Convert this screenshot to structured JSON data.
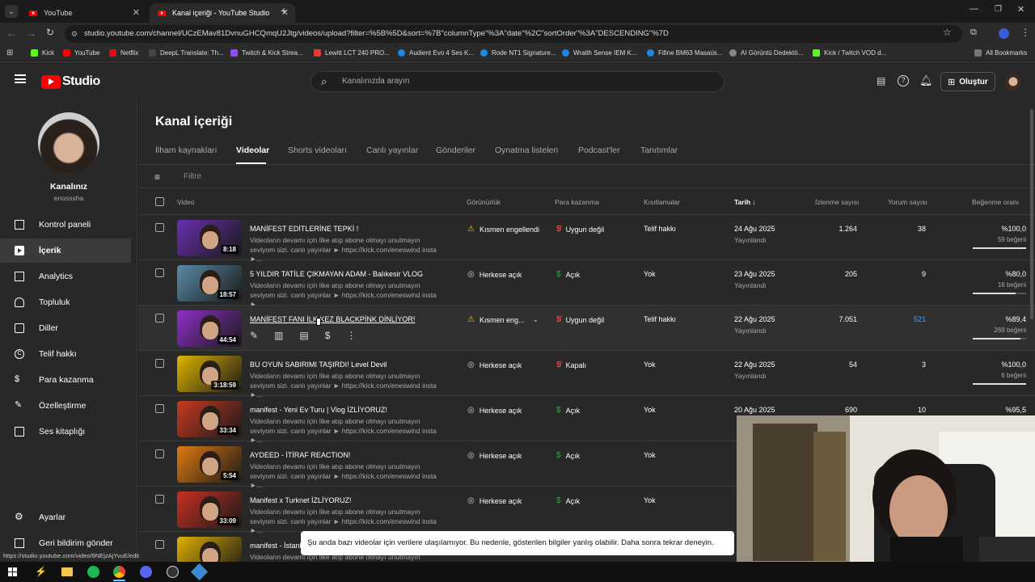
{
  "browser": {
    "tabs": [
      {
        "label": "YouTube"
      },
      {
        "label": "Kanal içeriği - YouTube Studio"
      }
    ],
    "url": "studio.youtube.com/channel/UCzEMav81DvnuGHCQmqU2Jtg/videos/upload?filter=%5B%5D&sort=%7B\"columnType\"%3A\"date\"%2C\"sortOrder\"%3A\"DESCENDING\"%7D",
    "bookmarks": [
      "Kick",
      "YouTube",
      "Netflix",
      "DeepL Translate: Th...",
      "Twitch & Kick Strea...",
      "Lewitt LCT 240 PRO...",
      "Audient Evo 4 Ses K...",
      "Rode NT1 Signature...",
      "Wraith Sense IEM K...",
      "Fifine BM63 Masaüs...",
      "AI Görüntü Dedektö...",
      "Kick / Twitch VOD d...",
      "All Bookmarks"
    ],
    "status_url": "https://studio.youtube.com/video/9NEjzAjYvuE/edit"
  },
  "header": {
    "logo_text": "Studio",
    "search_placeholder": "Kanalınızda arayın",
    "create_label": "Oluştur"
  },
  "sidebar": {
    "channel_title": "Kanalınız",
    "channel_handle": "enosssha",
    "items": [
      {
        "label": "Kontrol paneli",
        "icon": "dashboard-icon"
      },
      {
        "label": "İçerik",
        "icon": "content-icon"
      },
      {
        "label": "Analytics",
        "icon": "analytics-icon"
      },
      {
        "label": "Topluluk",
        "icon": "community-icon"
      },
      {
        "label": "Diller",
        "icon": "subtitles-icon"
      },
      {
        "label": "Telif hakkı",
        "icon": "copyright-icon"
      },
      {
        "label": "Para kazanma",
        "icon": "monetization-icon"
      },
      {
        "label": "Özelleştirme",
        "icon": "customization-icon"
      },
      {
        "label": "Ses kitaplığı",
        "icon": "audio-library-icon"
      }
    ],
    "bottom": [
      {
        "label": "Ayarlar",
        "icon": "settings-icon"
      },
      {
        "label": "Geri bildirim gönder",
        "icon": "feedback-icon"
      }
    ]
  },
  "main": {
    "page_title": "Kanal içeriği",
    "tabs": [
      "İlham kaynakları",
      "Videolar",
      "Shorts videoları",
      "Canlı yayınlar",
      "Gönderiler",
      "Oynatma listeleri",
      "Podcast'ler",
      "Tanıtımlar"
    ],
    "filter_placeholder": "Filtre",
    "columns": {
      "video": "Video",
      "visibility": "Görünürlük",
      "monetization": "Para kazanma",
      "restrictions": "Kısıtlamalar",
      "date": "Tarih",
      "views": "İzlenme sayısı",
      "comments": "Yorum sayısı",
      "likes": "Beğenme oranı"
    },
    "rows": [
      {
        "title": "MANİFEST EDİTLERİNE TEPKİ !",
        "desc": "Videoların devamı için like atıp abone olmayı unutmayın seviyom sizi. canlı yayınlar ► https://kick.com/eneswind insta ►...",
        "duration": "8:18",
        "visibility": "Kısmen engellendi",
        "vis_icon": "warning-icon",
        "monetization": "Uygun değil",
        "mon_icon": "monetization-off-icon",
        "restrictions": "Telif hakkı",
        "date": "24 Ağu 2025",
        "status": "Yayınlandı",
        "views": "1.264",
        "comments": "38",
        "likes": "%100,0",
        "likes_count": "59 beğeni",
        "like_fraction": 1.0,
        "thumb_color": "#6a2fb0"
      },
      {
        "title": "5 YILDIR TATİLE ÇIKMAYAN ADAM - Balıkesir VLOG",
        "desc": "Videoların devamı için like atıp abone olmayı unutmayın seviyom sizi. canlı yayınlar ► https://kick.com/eneswind insta ►...",
        "duration": "18:57",
        "visibility": "Herkese açık",
        "vis_icon": "public-icon",
        "monetization": "Açık",
        "mon_icon": "monetization-on-icon",
        "restrictions": "Yok",
        "date": "23 Ağu 2025",
        "status": "Yayınlandı",
        "views": "205",
        "comments": "9",
        "likes": "%80,0",
        "likes_count": "16 beğeni",
        "like_fraction": 0.8,
        "thumb_color": "#5a8aa8"
      },
      {
        "title": "MANİFEST FANI İLK KEZ BLACKPİNK DİNLİYOR!",
        "desc": "",
        "duration": "44:54",
        "visibility": "Kısmen eng...",
        "vis_icon": "warning-icon",
        "monetization": "Uygun değil",
        "mon_icon": "monetization-off-icon",
        "restrictions": "Telif hakkı",
        "date": "22 Ağu 2025",
        "status": "Yayınlandı",
        "views": "7.051",
        "comments": "521",
        "likes": "%89,4",
        "likes_count": "269 beğeni",
        "like_fraction": 0.894,
        "thumb_color": "#8e2fc8"
      },
      {
        "title": "BU OYUN SABIRIMI TAŞIRDI! Level Devil",
        "desc": "Videoların devamı için like atıp abone olmayı unutmayın seviyom sizi. canlı yayınlar ► https://kick.com/eneswind insta ►...",
        "duration": "3:18:59",
        "visibility": "Herkese açık",
        "vis_icon": "public-icon",
        "monetization": "Kapalı",
        "mon_icon": "monetization-off-icon",
        "restrictions": "Yok",
        "date": "22 Ağu 2025",
        "status": "Yayınlandı",
        "views": "54",
        "comments": "3",
        "likes": "%100,0",
        "likes_count": "6 beğeni",
        "like_fraction": 1.0,
        "thumb_color": "#e0b400"
      },
      {
        "title": "manifest - Yeni Ev Turu | Vlog İZLİYORUZ!",
        "desc": "Videoların devamı için like atıp abone olmayı unutmayın seviyom sizi. canlı yayınlar ► https://kick.com/eneswind insta ►...",
        "duration": "33:34",
        "visibility": "Herkese açık",
        "vis_icon": "public-icon",
        "monetization": "Açık",
        "mon_icon": "monetization-on-icon",
        "restrictions": "Yok",
        "date": "20 Ağu 2025",
        "status": "",
        "views": "690",
        "comments": "10",
        "likes": "%95,5",
        "likes_count": "",
        "like_fraction": 0.955,
        "thumb_color": "#c83a20"
      },
      {
        "title": "AYDEED - İTİRAF REACTION!",
        "desc": "Videoların devamı için like atıp abone olmayı unutmayın seviyom sizi. canlı yayınlar ► https://kick.com/eneswind insta ►...",
        "duration": "5:54",
        "visibility": "Herkese açık",
        "vis_icon": "public-icon",
        "monetization": "Açık",
        "mon_icon": "monetization-on-icon",
        "restrictions": "Yok",
        "date": "",
        "status": "",
        "views": "",
        "comments": "",
        "likes": "",
        "likes_count": "",
        "like_fraction": 0,
        "thumb_color": "#e07a10"
      },
      {
        "title": "Manifest x Turknet İZLİYORUZ!",
        "desc": "Videoların devamı için like atıp abone olmayı unutmayın seviyom sizi. canlı yayınlar ► https://kick.com/eneswind insta ►...",
        "duration": "33:09",
        "visibility": "Herkese açık",
        "vis_icon": "public-icon",
        "monetization": "Açık",
        "mon_icon": "monetization-on-icon",
        "restrictions": "Yok",
        "date": "",
        "status": "",
        "views": "",
        "comments": "",
        "likes": "",
        "likes_count": "",
        "like_fraction": 0,
        "thumb_color": "#c83020"
      },
      {
        "title": "manifest - İstanb",
        "desc": "Videoların devamı için like atıp abone olmayı unutmayın seviyom",
        "duration": "",
        "visibility": "",
        "vis_icon": "",
        "monetization": "",
        "mon_icon": "",
        "restrictions": "",
        "date": "",
        "status": "",
        "views": "",
        "comments": "",
        "likes": "",
        "likes_count": "",
        "like_fraction": 0,
        "thumb_color": "#e0b000"
      }
    ]
  },
  "toast": {
    "message": "Şu anda bazı videolar için verilere ulaşılamıyor. Bu nedenle, gösterilen bilgiler yanlış olabilir. Daha sonra tekrar deneyin."
  }
}
